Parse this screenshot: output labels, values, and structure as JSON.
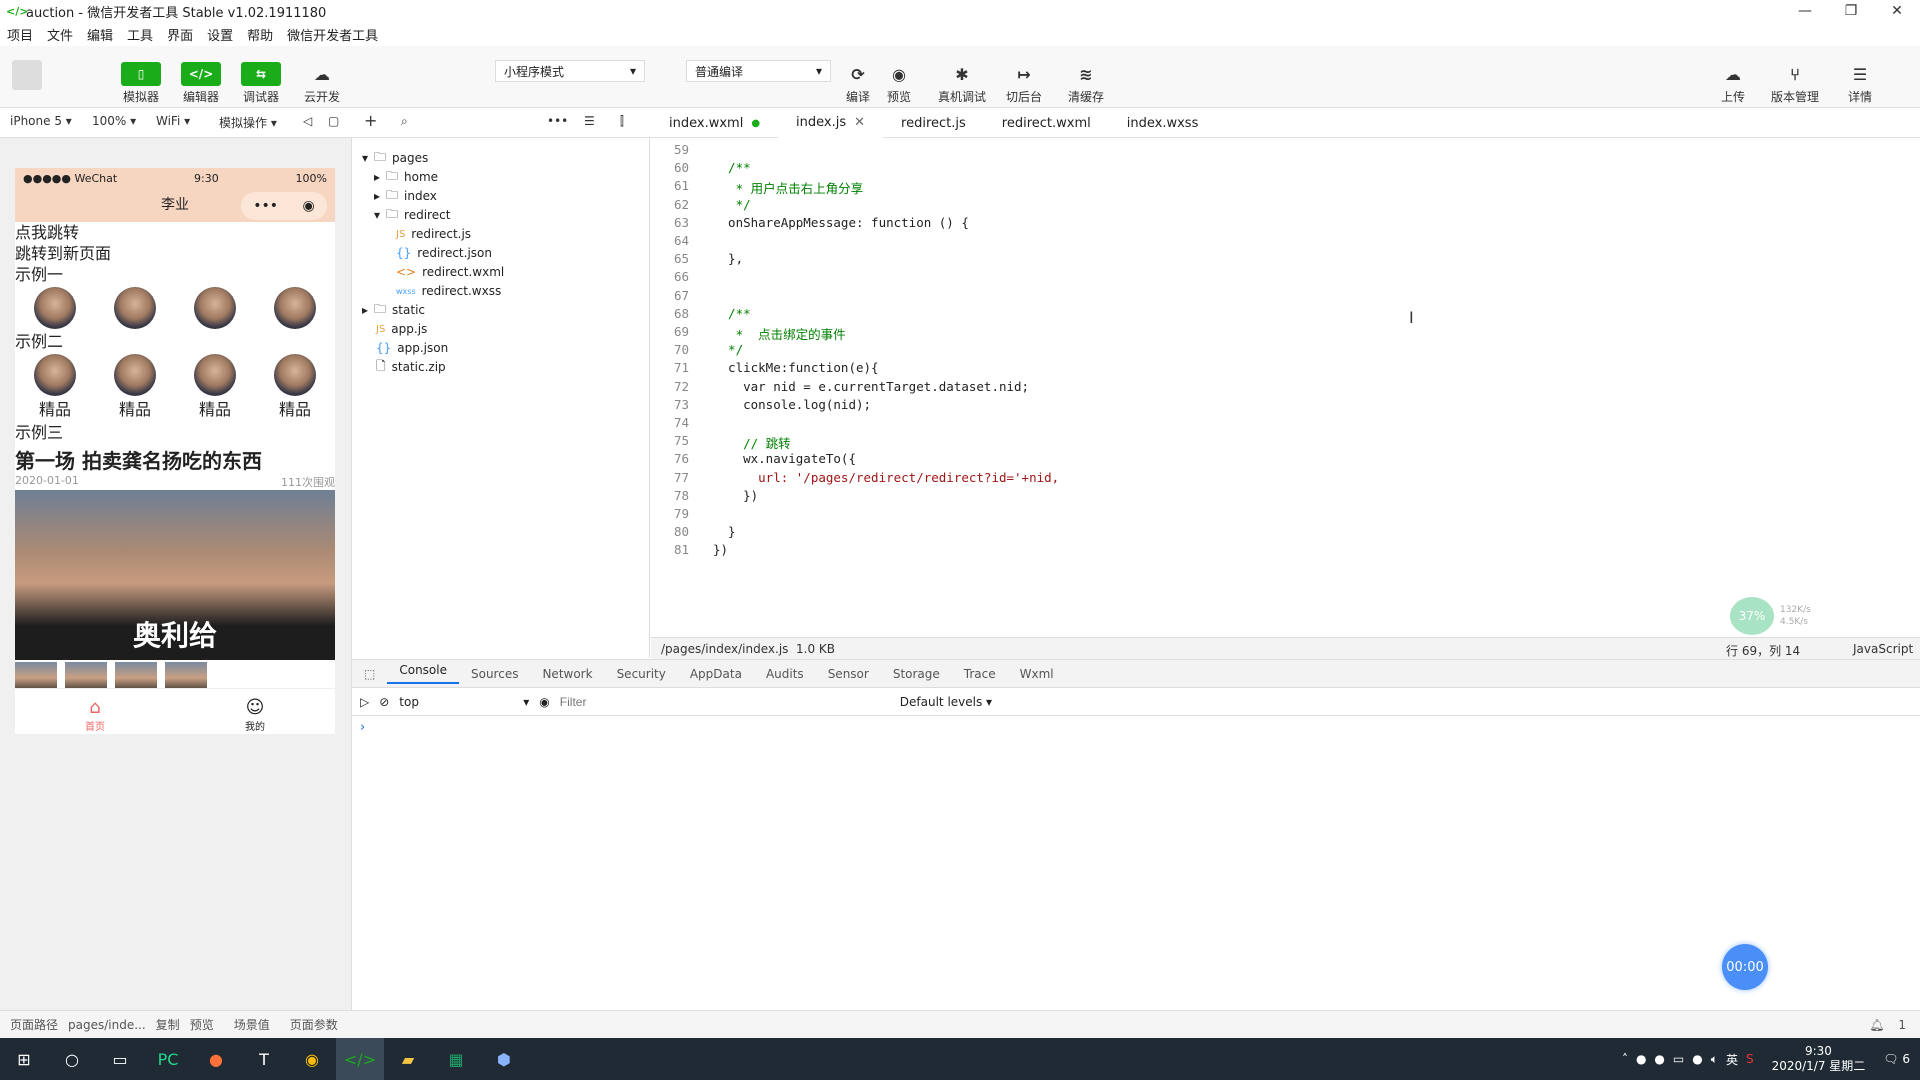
{
  "window": {
    "title": "auction - 微信开发者工具 Stable v1.02.1911180",
    "min": "—",
    "max": "❐",
    "close": "✕"
  },
  "menu": [
    "项目",
    "文件",
    "编辑",
    "工具",
    "界面",
    "设置",
    "帮助",
    "微信开发者工具"
  ],
  "toolbar": {
    "simulator": "模拟器",
    "editor": "编辑器",
    "debugger": "调试器",
    "cloud": "云开发",
    "mode": "小程序模式",
    "compile_mode": "普通编译",
    "compile": "编译",
    "preview": "预览",
    "real_debug": "真机调试",
    "background": "切后台",
    "clear_cache": "清缓存",
    "upload": "上传",
    "version": "版本管理",
    "details": "详情"
  },
  "device": {
    "model": "iPhone 5",
    "zoom": "100%",
    "network": "WiFi",
    "ops": "模拟操作"
  },
  "phone": {
    "carrier": "●●●●● WeChat",
    "time": "9:30",
    "battery": "100%",
    "nav_title": "李业",
    "line1": "点我跳转",
    "line2": "跳转到新页面",
    "ex1": "示例一",
    "ex2": "示例二",
    "ex3": "示例三",
    "tag": "精品",
    "headline": "第一场 拍卖龚名扬吃的东西",
    "date": "2020-01-01",
    "views": "111次围观",
    "hero_caption": "奥利给",
    "tab_home": "首页",
    "tab_me": "我的"
  },
  "tree": {
    "pages": "pages",
    "home": "home",
    "index": "index",
    "redirect": "redirect",
    "rjs": "redirect.js",
    "rjson": "redirect.json",
    "rwxml": "redirect.wxml",
    "rwxss": "redirect.wxss",
    "static": "static",
    "appjs": "app.js",
    "appjson": "app.json",
    "zip": "static.zip"
  },
  "tabs": [
    "index.wxml",
    "index.js",
    "redirect.js",
    "redirect.wxml",
    "index.wxss"
  ],
  "code": [
    {
      "n": "59",
      "t": ""
    },
    {
      "n": "60",
      "t": "  /**"
    },
    {
      "n": "61",
      "t": "   * 用户点击右上角分享"
    },
    {
      "n": "62",
      "t": "   */"
    },
    {
      "n": "63",
      "t": "  onShareAppMessage: function () {"
    },
    {
      "n": "64",
      "t": ""
    },
    {
      "n": "65",
      "t": "  },"
    },
    {
      "n": "66",
      "t": ""
    },
    {
      "n": "67",
      "t": ""
    },
    {
      "n": "68",
      "t": "  /**"
    },
    {
      "n": "69",
      "t": "   *  点击绑定的事件"
    },
    {
      "n": "70",
      "t": "  */"
    },
    {
      "n": "71",
      "t": "  clickMe:function(e){"
    },
    {
      "n": "72",
      "t": "    var nid = e.currentTarget.dataset.nid;"
    },
    {
      "n": "73",
      "t": "    console.log(nid);"
    },
    {
      "n": "74",
      "t": ""
    },
    {
      "n": "75",
      "t": "    // 跳转"
    },
    {
      "n": "76",
      "t": "    wx.navigateTo({"
    },
    {
      "n": "77",
      "t": "      url: '/pages/redirect/redirect?id='+nid,"
    },
    {
      "n": "78",
      "t": "    })"
    },
    {
      "n": "79",
      "t": ""
    },
    {
      "n": "80",
      "t": "  }"
    },
    {
      "n": "81",
      "t": "})"
    }
  ],
  "status": {
    "path": "/pages/index/index.js",
    "size": "1.0 KB",
    "pos": "行 69，列 14",
    "lang": "JavaScript"
  },
  "devtools": {
    "tabs": [
      "Console",
      "Sources",
      "Network",
      "Security",
      "AppData",
      "Audits",
      "Sensor",
      "Storage",
      "Trace",
      "Wxml"
    ],
    "context": "top",
    "filter_ph": "Filter",
    "levels": "Default levels ▾",
    "prompt": "›"
  },
  "bottom": {
    "path_label": "页面路径",
    "path": "pages/inde...",
    "copy": "复制",
    "preview": "预览",
    "scene": "场景值",
    "params": "页面参数",
    "notify": "1"
  },
  "taskbar": {
    "time": "9:30",
    "date": "2020/1/7 星期二",
    "ime": "英",
    "notif": "6"
  },
  "floating": {
    "timer": "00:00",
    "percent": "37%",
    "up": "132K/s",
    "down": "4.5K/s"
  }
}
